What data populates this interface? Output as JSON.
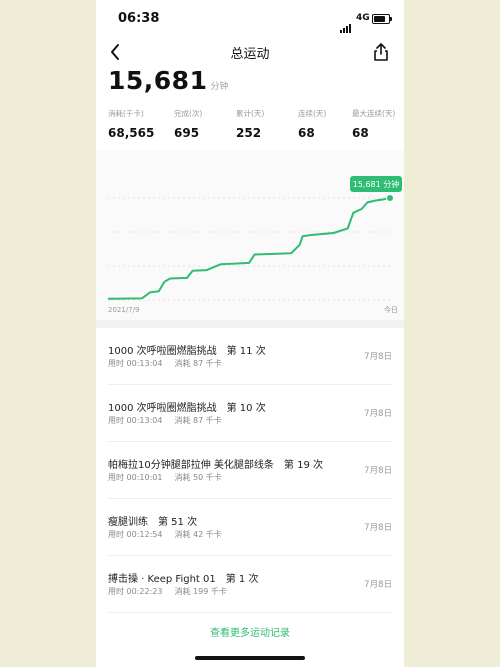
{
  "status": {
    "time": "06:38",
    "network": "4G"
  },
  "header": {
    "title": "总运动"
  },
  "total": {
    "value": "15,681",
    "unit": "分钟"
  },
  "stats": [
    {
      "label": "消耗(千卡)",
      "value": "68,565"
    },
    {
      "label": "完成(次)",
      "value": "695"
    },
    {
      "label": "累计(天)",
      "value": "252"
    },
    {
      "label": "连续(天)",
      "value": "68"
    },
    {
      "label": "最大连续(天)",
      "value": "68"
    }
  ],
  "chart_data": {
    "type": "area",
    "x_labels": [
      "2021/7/9",
      "今日"
    ],
    "tooltip": "15,681 分钟",
    "accent": "#2ebd72",
    "x": [
      0,
      0.05,
      0.12,
      0.15,
      0.18,
      0.2,
      0.22,
      0.28,
      0.3,
      0.35,
      0.4,
      0.45,
      0.5,
      0.52,
      0.6,
      0.65,
      0.68,
      0.69,
      0.72,
      0.8,
      0.85,
      0.86,
      0.87,
      0.9,
      0.92,
      0.95,
      0.98,
      1.0
    ],
    "values": [
      200,
      220,
      240,
      1200,
      1350,
      2800,
      3300,
      3400,
      4500,
      4600,
      5500,
      5600,
      5700,
      7000,
      7100,
      7200,
      8500,
      9800,
      10000,
      10300,
      11000,
      12200,
      13400,
      14000,
      15000,
      15300,
      15500,
      15681
    ]
  },
  "records": [
    {
      "title": "1000 次呼啦圈燃脂挑战　第 11 次",
      "duration": "用时 00:13:04",
      "calories": "消耗 87 千卡",
      "date": "7月8日"
    },
    {
      "title": "1000 次呼啦圈燃脂挑战　第 10 次",
      "duration": "用时 00:13:04",
      "calories": "消耗 87 千卡",
      "date": "7月8日"
    },
    {
      "title": "帕梅拉10分钟腿部拉伸 美化腿部线条　第 19 次",
      "duration": "用时 00:10:01",
      "calories": "消耗 50 千卡",
      "date": "7月8日"
    },
    {
      "title": "瘦腿训练　第 51 次",
      "duration": "用时 00:12:54",
      "calories": "消耗 42 千卡",
      "date": "7月8日"
    },
    {
      "title": "搏击操 · Keep Fight 01　第 1 次",
      "duration": "用时 00:22:23",
      "calories": "消耗 199 千卡",
      "date": "7月8日"
    }
  ],
  "more_link": "查看更多运动记录"
}
